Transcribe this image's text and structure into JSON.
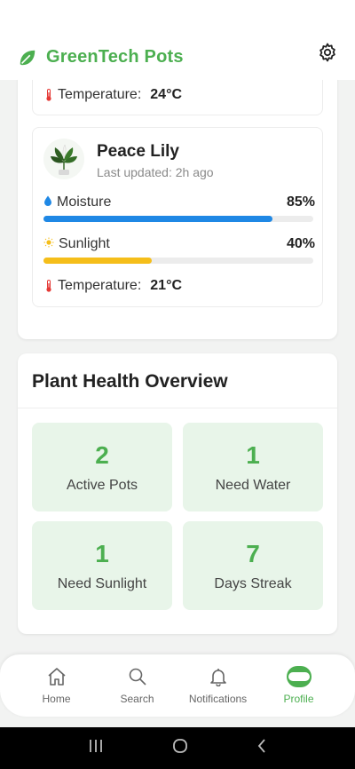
{
  "app": {
    "title": "GreenTech Pots",
    "accent_color": "#4caf50"
  },
  "header": {
    "settings_icon": "gear-icon"
  },
  "plants": [
    {
      "partial": true,
      "bar_level": 0.8,
      "bar_color": "#f5be1a",
      "temperature_label": "Temperature:",
      "temperature_value": "24°C"
    },
    {
      "name": "Peace Lily",
      "updated": "Last updated: 2h ago",
      "moisture_label": "Moisture",
      "moisture_value": "85%",
      "moisture_level": 0.85,
      "sunlight_label": "Sunlight",
      "sunlight_value": "40%",
      "sunlight_level": 0.4,
      "temperature_label": "Temperature:",
      "temperature_value": "21°C"
    }
  ],
  "overview": {
    "title": "Plant Health Overview",
    "stats": [
      {
        "value": "2",
        "label": "Active Pots"
      },
      {
        "value": "1",
        "label": "Need Water"
      },
      {
        "value": "1",
        "label": "Need Sunlight"
      },
      {
        "value": "7",
        "label": "Days Streak"
      }
    ]
  },
  "nav": {
    "items": [
      {
        "label": "Home",
        "icon": "home-icon"
      },
      {
        "label": "Search",
        "icon": "search-icon"
      },
      {
        "label": "Notifications",
        "icon": "bell-icon"
      },
      {
        "label": "Profile",
        "icon": "profile-icon",
        "active": true
      }
    ]
  }
}
